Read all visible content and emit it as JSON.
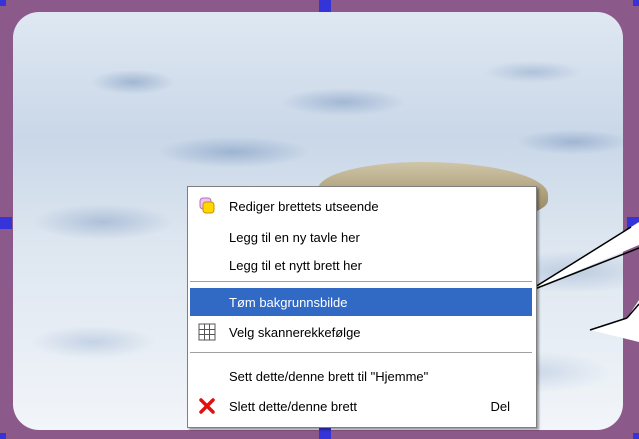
{
  "menu": {
    "items": [
      {
        "label": "Rediger brettets utseende",
        "icon": "palette-icon"
      },
      {
        "label": "Legg til en ny tavle her"
      },
      {
        "label": "Legg til et nytt brett her"
      },
      {
        "label": "Tøm bakgrunnsbilde",
        "selected": true
      },
      {
        "label": "Velg skannerekkefølge",
        "icon": "grid-icon"
      },
      {
        "label": "Sett dette/denne brett til \"Hjemme\""
      },
      {
        "label": "Slett dette/denne brett",
        "shortcut": "Del",
        "icon": "delete-x-icon"
      }
    ]
  },
  "colors": {
    "frame": "#8c5a8a",
    "handle": "#3434d8",
    "selection": "#316ac5"
  }
}
